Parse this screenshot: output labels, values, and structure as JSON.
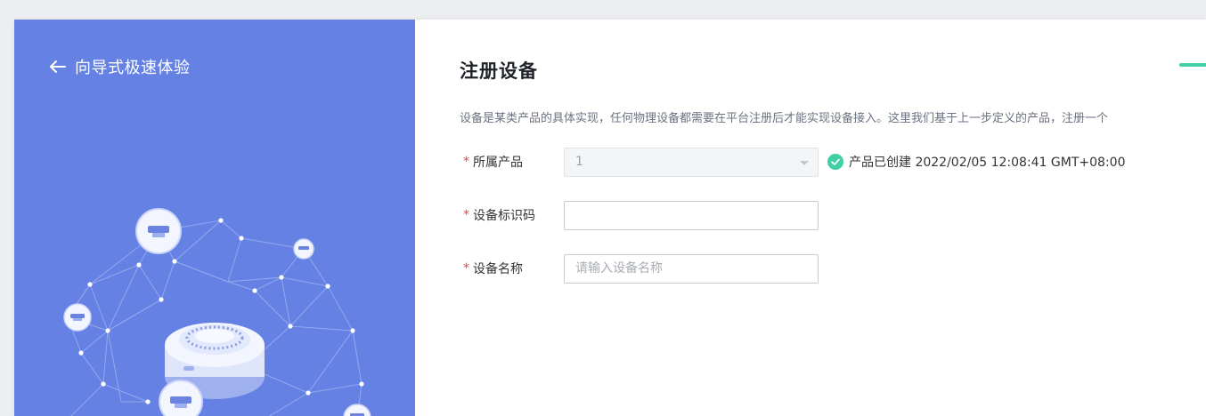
{
  "guide": {
    "back_label": "向导式极速体验"
  },
  "form": {
    "title": "注册设备",
    "description": "设备是某类产品的具体实现，任何物理设备都需要在平台注册后才能实现设备接入。这里我们基于上一步定义的产品，注册一个",
    "required_mark": "*",
    "product": {
      "label": "所属产品",
      "value": "1",
      "status_text": "产品已创建 2022/02/05 12:08:41 GMT+08:00"
    },
    "device_id": {
      "label": "设备标识码",
      "value": ""
    },
    "device_name": {
      "label": "设备名称",
      "placeholder": "请输入设备名称"
    }
  },
  "colors": {
    "left_panel": "#6581e4",
    "accent_green": "#3fd0a5",
    "required": "#e5484d"
  }
}
